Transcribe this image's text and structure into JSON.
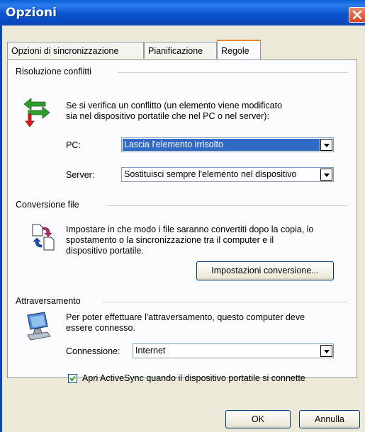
{
  "window": {
    "title": "Opzioni"
  },
  "tabs": [
    {
      "label": "Opzioni di sincronizzazione"
    },
    {
      "label": "Pianificazione"
    },
    {
      "label": "Regole"
    }
  ],
  "conflict": {
    "heading": "Risoluzione conflitti",
    "description_line1": "Se si verifica un conflitto (un elemento viene modificato",
    "description_line2": "sia nel dispositivo portatile che nel PC o nel server):",
    "pc_label": "PC:",
    "pc_value": "Lascia l'elemento irrisolto",
    "server_label": "Server:",
    "server_value": "Sostituisci sempre l'elemento nel dispositivo"
  },
  "conversion": {
    "heading": "Conversione file",
    "description_line1": "Impostare in che modo i file saranno convertiti dopo la copia, lo",
    "description_line2": "spostamento o la sincronizzazione tra il computer e il",
    "description_line3": "dispositivo portatile.",
    "settings_button": "Impostazioni conversione..."
  },
  "passthrough": {
    "heading": "Attraversamento",
    "description_line1": "Per poter effettuare l'attraversamento, questo computer deve",
    "description_line2": "essere connesso.",
    "connection_label": "Connessione:",
    "connection_value": "Internet",
    "open_activesync_label": "Apri ActiveSync quando il dispositivo portatile si connette",
    "open_activesync_checked": true
  },
  "footer": {
    "ok_label": "OK",
    "cancel_label": "Annulla"
  },
  "colors": {
    "titlebar": "#0c55d0",
    "selection": "#316ac5",
    "tab_highlight": "#e68b2c"
  }
}
